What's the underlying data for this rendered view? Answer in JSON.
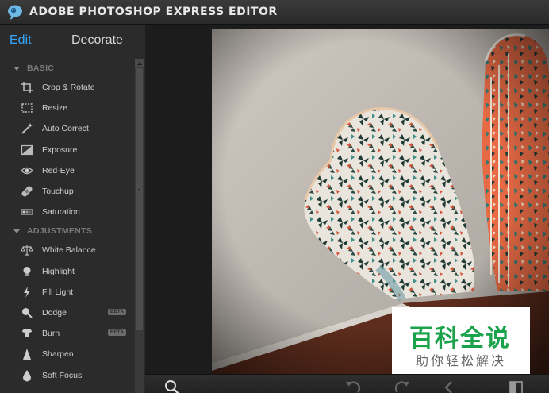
{
  "app": {
    "title": "ADOBE PHOTOSHOP EXPRESS EDITOR",
    "logo_icon": "photoshop-express-eye-icon"
  },
  "sidebar": {
    "tabs": [
      {
        "label": "Edit",
        "active": true,
        "color": "#35a6ff"
      },
      {
        "label": "Decorate",
        "active": false
      }
    ],
    "sections": [
      {
        "title": "BASIC",
        "items": [
          {
            "label": "Crop & Rotate",
            "icon": "crop-icon"
          },
          {
            "label": "Resize",
            "icon": "resize-icon"
          },
          {
            "label": "Auto Correct",
            "icon": "magic-wand-icon"
          },
          {
            "label": "Exposure",
            "icon": "exposure-icon"
          },
          {
            "label": "Red-Eye",
            "icon": "eye-icon"
          },
          {
            "label": "Touchup",
            "icon": "bandage-icon"
          },
          {
            "label": "Saturation",
            "icon": "saturation-icon"
          }
        ]
      },
      {
        "title": "ADJUSTMENTS",
        "items": [
          {
            "label": "White Balance",
            "icon": "scales-icon"
          },
          {
            "label": "Highlight",
            "icon": "lightbulb-icon"
          },
          {
            "label": "Fill Light",
            "icon": "lightning-icon"
          },
          {
            "label": "Dodge",
            "icon": "dodge-icon",
            "badge": "BETA"
          },
          {
            "label": "Burn",
            "icon": "burn-icon",
            "badge": "BETA"
          },
          {
            "label": "Sharpen",
            "icon": "sharpen-icon"
          },
          {
            "label": "Soft Focus",
            "icon": "droplet-icon"
          }
        ]
      }
    ]
  },
  "bottom_toolbar": {
    "icons": [
      "zoom-icon",
      "undo-icon",
      "redo-icon",
      "back-icon",
      "compare-icon"
    ]
  },
  "watermark": {
    "main": "百科全说",
    "sub": "助你轻松解决",
    "color": "#1aa34a"
  }
}
